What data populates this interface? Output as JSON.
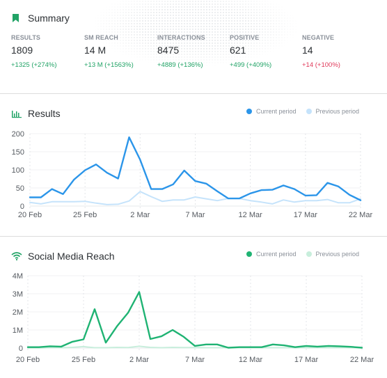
{
  "summary": {
    "title": "Summary",
    "icon": "bookmark-icon",
    "kpis": [
      {
        "label": "RESULTS",
        "value": "1809",
        "delta": "+1325 (+274%)",
        "trend": "positive"
      },
      {
        "label": "SM REACH",
        "value": "14 M",
        "delta": "+13 M (+1563%)",
        "trend": "positive"
      },
      {
        "label": "INTERACTIONS",
        "value": "8475",
        "delta": "+4889 (+136%)",
        "trend": "positive"
      },
      {
        "label": "POSITIVE",
        "value": "621",
        "delta": "+499 (+409%)",
        "trend": "positive"
      },
      {
        "label": "NEGATIVE",
        "value": "14",
        "delta": "+14 (+100%)",
        "trend": "negative"
      }
    ]
  },
  "colors": {
    "positive": "#21a366",
    "negative": "#e0395a",
    "results_current": "#2b95e9",
    "results_previous": "#c5e3fb",
    "reach_current": "#1fb373",
    "reach_previous": "#c8eedc"
  },
  "chart_data": [
    {
      "type": "line",
      "title": "Results",
      "icon": "bar-chart-icon",
      "xlabel": "",
      "ylabel": "",
      "x": [
        "20 Feb",
        "21 Feb",
        "22 Feb",
        "23 Feb",
        "24 Feb",
        "25 Feb",
        "26 Feb",
        "27 Feb",
        "28 Feb",
        "1 Mar",
        "2 Mar",
        "3 Mar",
        "4 Mar",
        "5 Mar",
        "6 Mar",
        "7 Mar",
        "8 Mar",
        "9 Mar",
        "10 Mar",
        "11 Mar",
        "12 Mar",
        "13 Mar",
        "14 Mar",
        "15 Mar",
        "16 Mar",
        "17 Mar",
        "18 Mar",
        "19 Mar",
        "20 Mar",
        "21 Mar",
        "22 Mar"
      ],
      "x_ticks": [
        "20 Feb",
        "25 Feb",
        "2 Mar",
        "7 Mar",
        "12 Mar",
        "17 Mar",
        "22 Mar"
      ],
      "x_tick_index": [
        0,
        5,
        10,
        15,
        20,
        25,
        30
      ],
      "y_ticks": [
        0,
        50,
        100,
        150,
        200
      ],
      "y_tick_labels": [
        "0",
        "50",
        "100",
        "150",
        "200"
      ],
      "ylim": [
        0,
        200
      ],
      "grid": true,
      "legend_position": "top-right",
      "series": [
        {
          "name": "Current period",
          "values": [
            24,
            24,
            47,
            33,
            73,
            99,
            115,
            92,
            76,
            190,
            128,
            47,
            47,
            60,
            98,
            69,
            62,
            41,
            21,
            21,
            35,
            44,
            45,
            57,
            47,
            29,
            30,
            64,
            54,
            31,
            16
          ]
        },
        {
          "name": "Previous period",
          "values": [
            10,
            6,
            12,
            12,
            12,
            13,
            8,
            4,
            5,
            14,
            40,
            26,
            13,
            17,
            17,
            25,
            20,
            15,
            21,
            21,
            15,
            11,
            6,
            17,
            11,
            15,
            15,
            18,
            9,
            9,
            20
          ]
        }
      ]
    },
    {
      "type": "line",
      "title": "Social Media Reach",
      "icon": "wifi-icon",
      "xlabel": "",
      "ylabel": "",
      "x": [
        "20 Feb",
        "21 Feb",
        "22 Feb",
        "23 Feb",
        "24 Feb",
        "25 Feb",
        "26 Feb",
        "27 Feb",
        "28 Feb",
        "1 Mar",
        "2 Mar",
        "3 Mar",
        "4 Mar",
        "5 Mar",
        "6 Mar",
        "7 Mar",
        "8 Mar",
        "9 Mar",
        "10 Mar",
        "11 Mar",
        "12 Mar",
        "13 Mar",
        "14 Mar",
        "15 Mar",
        "16 Mar",
        "17 Mar",
        "18 Mar",
        "19 Mar",
        "20 Mar",
        "21 Mar",
        "22 Mar"
      ],
      "x_ticks": [
        "20 Feb",
        "25 Feb",
        "2 Mar",
        "7 Mar",
        "12 Mar",
        "17 Mar",
        "22 Mar"
      ],
      "x_tick_index": [
        0,
        5,
        10,
        15,
        20,
        25,
        30
      ],
      "y_ticks": [
        0,
        1000000,
        2000000,
        3000000,
        4000000
      ],
      "y_tick_labels": [
        "0",
        "1M",
        "2M",
        "3M",
        "4M"
      ],
      "ylim": [
        0,
        4000000
      ],
      "grid": true,
      "legend_position": "top-right",
      "series": [
        {
          "name": "Current period",
          "values": [
            50000,
            50000,
            100000,
            80000,
            350000,
            480000,
            2150000,
            300000,
            1200000,
            1950000,
            3100000,
            500000,
            650000,
            1000000,
            620000,
            120000,
            200000,
            200000,
            20000,
            50000,
            50000,
            50000,
            200000,
            150000,
            50000,
            120000,
            80000,
            120000,
            100000,
            70000,
            20000
          ]
        },
        {
          "name": "Previous period",
          "values": [
            10000,
            10000,
            20000,
            20000,
            40000,
            80000,
            20000,
            20000,
            40000,
            30000,
            100000,
            40000,
            20000,
            40000,
            30000,
            30000,
            20000,
            20000,
            20000,
            20000,
            20000,
            20000,
            20000,
            20000,
            20000,
            20000,
            20000,
            20000,
            20000,
            20000,
            20000
          ]
        }
      ]
    }
  ]
}
